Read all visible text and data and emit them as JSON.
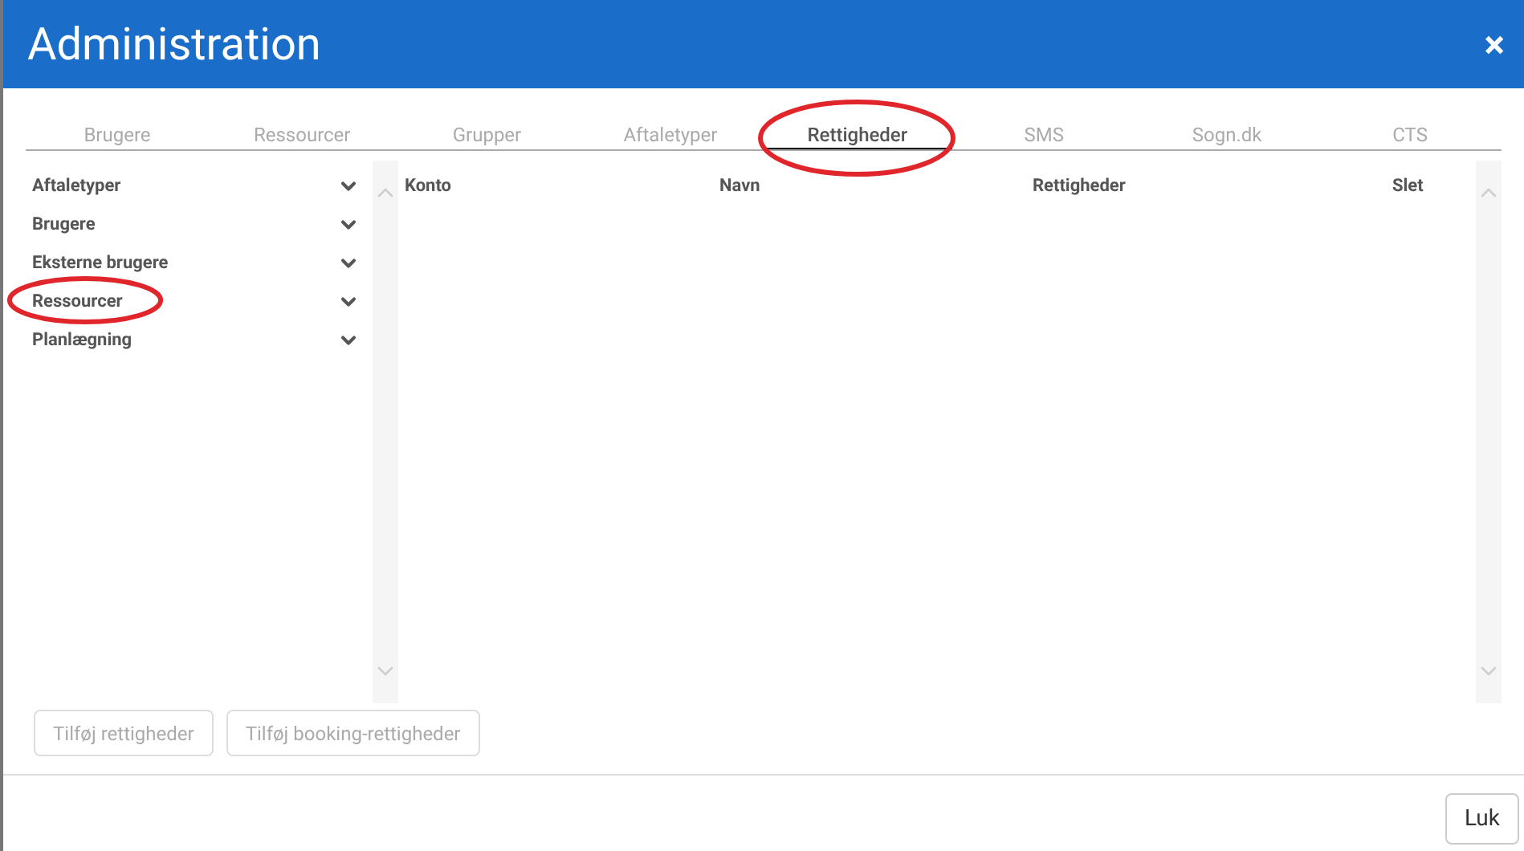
{
  "window": {
    "title": "Administration",
    "close": "×"
  },
  "tabs": [
    {
      "label": "Brugere",
      "selected": false,
      "circled": false
    },
    {
      "label": "Ressourcer",
      "selected": false,
      "circled": false
    },
    {
      "label": "Grupper",
      "selected": false,
      "circled": false
    },
    {
      "label": "Aftaletyper",
      "selected": false,
      "circled": false
    },
    {
      "label": "Rettigheder",
      "selected": true,
      "circled": true
    },
    {
      "label": "SMS",
      "selected": false,
      "circled": false
    },
    {
      "label": "Sogn.dk",
      "selected": false,
      "circled": false
    },
    {
      "label": "CTS",
      "selected": false,
      "circled": false
    }
  ],
  "sidebar": {
    "items": [
      {
        "label": "Aftaletyper",
        "expanded": false,
        "circled": false
      },
      {
        "label": "Brugere",
        "expanded": false,
        "circled": false
      },
      {
        "label": "Eksterne brugere",
        "expanded": false,
        "circled": false
      },
      {
        "label": "Ressourcer",
        "expanded": false,
        "circled": true
      },
      {
        "label": "Planlægning",
        "expanded": false,
        "circled": false
      }
    ]
  },
  "table": {
    "columns": [
      "Konto",
      "Navn",
      "Rettigheder",
      "Slet"
    ]
  },
  "actions": [
    {
      "label": "Tilføj rettigheder",
      "disabled": true
    },
    {
      "label": "Tilføj booking-rettigheder",
      "disabled": true
    }
  ],
  "footer": {
    "buttons": [
      {
        "label": "Luk"
      }
    ]
  }
}
